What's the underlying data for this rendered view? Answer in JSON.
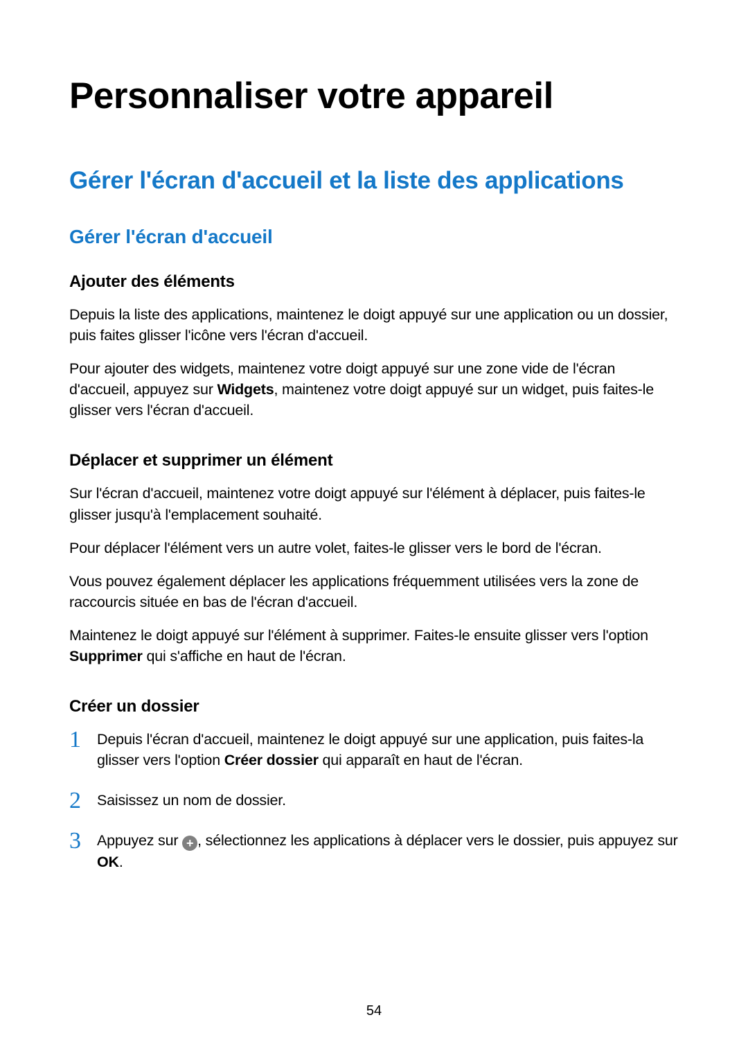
{
  "title": "Personnaliser votre appareil",
  "h2": "Gérer l'écran d'accueil et la liste des applications",
  "h3": "Gérer l'écran d'accueil",
  "section1": {
    "heading": "Ajouter des éléments",
    "p1": "Depuis la liste des applications, maintenez le doigt appuyé sur une application ou un dossier, puis faites glisser l'icône vers l'écran d'accueil.",
    "p2a": "Pour ajouter des widgets, maintenez votre doigt appuyé sur une zone vide de l'écran d'accueil, appuyez sur ",
    "p2b": "Widgets",
    "p2c": ", maintenez votre doigt appuyé sur un widget, puis faites-le glisser vers l'écran d'accueil."
  },
  "section2": {
    "heading": "Déplacer et supprimer un élément",
    "p1": "Sur l'écran d'accueil, maintenez votre doigt appuyé sur l'élément à déplacer, puis faites-le glisser jusqu'à l'emplacement souhaité.",
    "p2": "Pour déplacer l'élément vers un autre volet, faites-le glisser vers le bord de l'écran.",
    "p3": "Vous pouvez également déplacer les applications fréquemment utilisées vers la zone de raccourcis située en bas de l'écran d'accueil.",
    "p4a": "Maintenez le doigt appuyé sur l'élément à supprimer. Faites-le ensuite glisser vers l'option ",
    "p4b": "Supprimer",
    "p4c": " qui s'affiche en haut de l'écran."
  },
  "section3": {
    "heading": "Créer un dossier",
    "step1a": "Depuis l'écran d'accueil, maintenez le doigt appuyé sur une application, puis faites-la glisser vers l'option ",
    "step1b": "Créer dossier",
    "step1c": " qui apparaît en haut de l'écran.",
    "step2": "Saisissez un nom de dossier.",
    "step3a": "Appuyez sur ",
    "step3b": ", sélectionnez les applications à déplacer vers le dossier, puis appuyez sur ",
    "step3c": "OK",
    "step3d": "."
  },
  "pageNumber": "54",
  "icons": {
    "plus": "+"
  }
}
